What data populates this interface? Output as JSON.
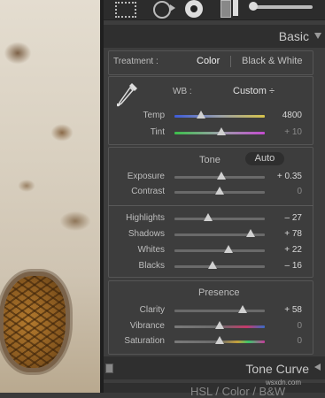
{
  "basic_panel": {
    "title": "Basic",
    "treatment_label": "Treatment :",
    "treatment_color": "Color",
    "treatment_bw": "Black & White",
    "wb_label": "WB :",
    "wb_value": "Custom ÷",
    "temp": {
      "label": "Temp",
      "value": "4800",
      "position": 0.33
    },
    "tint": {
      "label": "Tint",
      "value": "+ 10",
      "position": 0.52
    },
    "tone_label": "Tone",
    "auto_label": "Auto",
    "exposure": {
      "label": "Exposure",
      "value": "+ 0.35",
      "position": 0.52
    },
    "contrast": {
      "label": "Contrast",
      "value": "0",
      "position": 0.5
    },
    "highlights": {
      "label": "Highlights",
      "value": "– 27",
      "position": 0.37
    },
    "shadows": {
      "label": "Shadows",
      "value": "+ 78",
      "position": 0.85
    },
    "whites": {
      "label": "Whites",
      "value": "+ 22",
      "position": 0.6
    },
    "blacks": {
      "label": "Blacks",
      "value": "– 16",
      "position": 0.42
    },
    "presence_label": "Presence",
    "clarity": {
      "label": "Clarity",
      "value": "+ 58",
      "position": 0.76
    },
    "vibrance": {
      "label": "Vibrance",
      "value": "0",
      "position": 0.5
    },
    "saturation": {
      "label": "Saturation",
      "value": "0",
      "position": 0.5
    }
  },
  "tone_curve": {
    "title": "Tone Curve"
  },
  "next_panel": {
    "text": "HSL / Color / B&W"
  },
  "watermark": "wsxdn.com",
  "icons": [
    "crop-icon",
    "spot-removal-icon",
    "red-eye-icon",
    "graduated-filter-icon",
    "adjustment-brush-icon",
    "white-balance-dropper-icon",
    "collapse-triangle-icon"
  ],
  "colors": {
    "panel": "#3d3d3d",
    "header": "#2f2f2f",
    "text": "#c8c8c8"
  }
}
